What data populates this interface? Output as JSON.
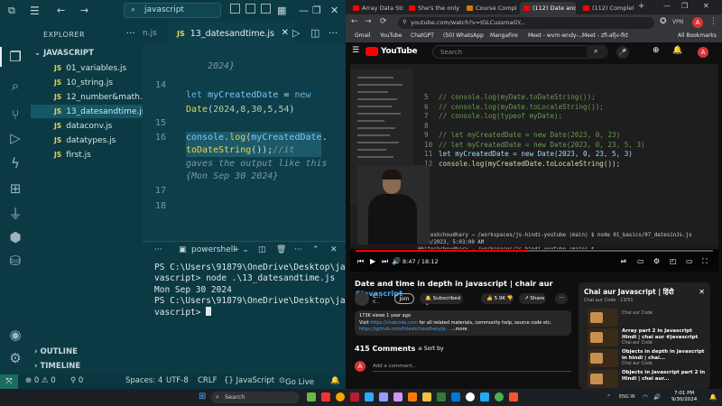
{
  "vscode": {
    "search": "javascript",
    "explorer_title": "EXPLORER",
    "more_icon": "ellipsis-icon",
    "folder": "JAVASCRIPT",
    "files": [
      {
        "name": "01_variables.js"
      },
      {
        "name": "10_string.js"
      },
      {
        "name": "12_number&math..."
      },
      {
        "name": "13_datesandtime.js"
      },
      {
        "name": "dataconv.js"
      },
      {
        "name": "datatypes.js"
      },
      {
        "name": "first.js"
      }
    ],
    "outline": "OUTLINE",
    "timeline": "TIMELINE",
    "prev_tab": "n.js",
    "active_tab": "13_datesandtime.js",
    "code": {
      "line_top_comment": "2024}",
      "ln14": "14",
      "line14": "let myCreatedDate = new",
      "line14b": "Date(2024,8,30,5,54)",
      "ln15": "15",
      "ln16": "16",
      "line16": "console.log(myCreatedDate.",
      "line16b": "toDateString());//it",
      "line16c": "gaves the output like this",
      "line16d": "{Mon Sep 30 2024}",
      "ln17": "17",
      "ln18": "18"
    },
    "terminal_label": "powershell",
    "terminal_lines": [
      "PS C:\\Users\\91879\\OneDrive\\Desktop\\ja",
      "vascript> node .\\13_datesandtime.js",
      "Mon Sep 30 2024",
      "PS C:\\Users\\91879\\OneDrive\\Desktop\\ja",
      "vascript> "
    ],
    "status": {
      "errors": "⊗ 0 ⚠ 0",
      "ports": "⚲ 0",
      "spaces": "Spaces: 4",
      "encoding": "UTF-8",
      "eol": "CRLF",
      "language": "{} JavaScript",
      "golive": "Go Live"
    }
  },
  "chrome": {
    "tabs": [
      {
        "label": "Array Data Structu..."
      },
      {
        "label": "She's the only hu..."
      },
      {
        "label": "Course Completi..."
      },
      {
        "label": "(112) Date and ..."
      },
      {
        "label": "(112) Complete C..."
      }
    ],
    "url": "youtube.com/watch?v=IGLCussmaGY...",
    "bookmarks": [
      "Gmail",
      "YouTube",
      "ChatGPT",
      "(50) WhatsApp",
      "MangaFire",
      "Meet - wvm-wndy-...",
      "Meet - zfi-afjv-fkt",
      "All Bookmarks"
    ],
    "vpn": "VPN",
    "profile_initial": "A"
  },
  "youtube": {
    "logo_text": "YouTube",
    "search_placeholder": "Search",
    "avatar": "A",
    "video_code_lines": [
      "// console.log(myDate.toDateString());",
      "// console.log(myDate.toLocaleString());",
      "// console.log(typeof myDate);",
      "",
      "// let myCreatedDate = new Date(2023, 0, 23)",
      "// let myCreatedDate = new Date(2023, 0, 23, 5, 3)",
      "let myCreatedDate = new Date(2023, 0, 23, 5, 3)",
      "console.log(myCreatedDate.toLocaleString());"
    ],
    "video_line_numbers": "5\n6\n7\n8\n9\n10\n11\n12",
    "video_terminal": "@hiteshchoudhary → /workspaces/js-hindi-youtube (main) $ node 01_basics/07_datesinJs.js\n1/23/2023, 5:03:00 AM\n@hiteshchoudhary → /workspaces/js-hindi-youtube (main) $",
    "time": "8:47 / 18:12",
    "progress": 0.48,
    "title": "Date and time in depth in javascript | chair aur ",
    "title_tag": "#javascript",
    "channel": "C...",
    "channel_subs": "6...",
    "join": "Join",
    "subscribed": "Subscribed ⌄",
    "likes": "👍 5.9K  👎",
    "share": "↗ Share",
    "dots": "···",
    "desc_line1": "173K views  1 year ago",
    "desc_line2": "Visit ",
    "desc_link1": "https://chaicode.com",
    "desc_line2b": " for all related materials, community help, source code etc.",
    "desc_link2": "https://github.com/hiteshchoudhary/js...",
    "desc_more": " ...more",
    "comments": "415 Comments",
    "sort_by": "≡  Sort by",
    "add_comment": "Add a comment...",
    "comment_avatar": "A",
    "playlist": {
      "title": "Chai aur Javascript | हिंदी",
      "sub": "Chai aur Code · 13/51",
      "close": "✕",
      "items": [
        {
          "title": "",
          "channel": "Chai aur Code"
        },
        {
          "title": "Array part 2 in Javascript Hindi | chai aur #javascript",
          "channel": "Chai aur Code"
        },
        {
          "title": "Objects in depth in javascript in hindi | chai...",
          "channel": "Chai aur Code"
        },
        {
          "title": "Objects in Javascript part 2 in Hindi | chai aur...",
          "channel": ""
        }
      ]
    }
  },
  "taskbar": {
    "search": "Search",
    "time": "7:01 PM",
    "date": "9/30/2024",
    "lang": "ENG IN"
  }
}
